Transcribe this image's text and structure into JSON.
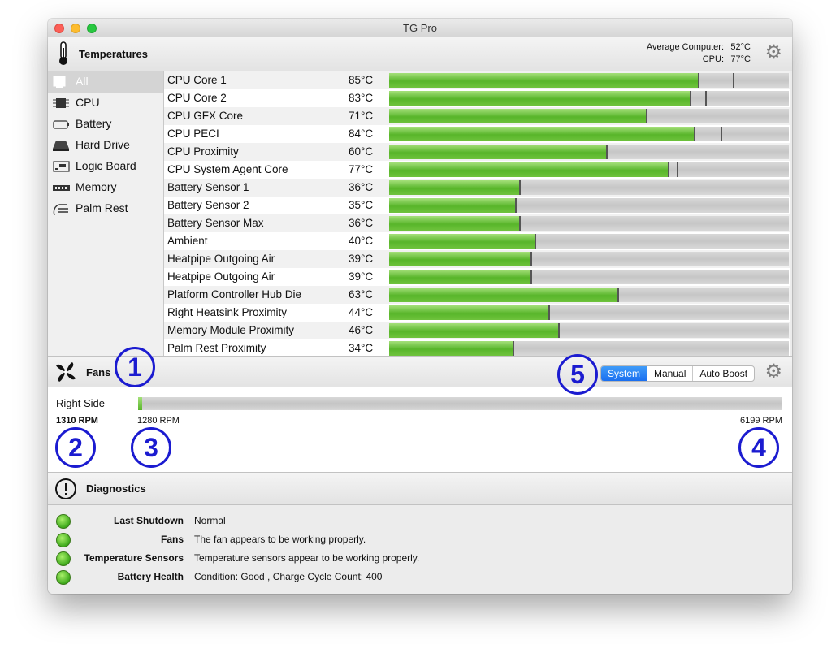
{
  "window": {
    "title": "TG Pro"
  },
  "temperatures": {
    "title": "Temperatures",
    "average_label": "Average Computer:",
    "average_value": "52°C",
    "cpu_label": "CPU:",
    "cpu_value": "77°C",
    "settings_icon": "gear-icon"
  },
  "sidebar": {
    "items": [
      {
        "label": "All",
        "icon": "all-icon",
        "selected": true
      },
      {
        "label": "CPU",
        "icon": "cpu-icon"
      },
      {
        "label": "Battery",
        "icon": "battery-icon"
      },
      {
        "label": "Hard Drive",
        "icon": "hard-drive-icon"
      },
      {
        "label": "Logic Board",
        "icon": "logic-board-icon"
      },
      {
        "label": "Memory",
        "icon": "memory-icon"
      },
      {
        "label": "Palm Rest",
        "icon": "palm-rest-icon"
      }
    ]
  },
  "sensors": [
    {
      "name": "CPU Core 1",
      "temp": "85°C",
      "level": 0.775,
      "max": 0.86
    },
    {
      "name": "CPU Core 2",
      "temp": "83°C",
      "level": 0.755,
      "max": 0.79
    },
    {
      "name": "CPU GFX Core",
      "temp": "71°C",
      "level": 0.645,
      "max": null
    },
    {
      "name": "CPU PECI",
      "temp": "84°C",
      "level": 0.765,
      "max": 0.83
    },
    {
      "name": "CPU Proximity",
      "temp": "60°C",
      "level": 0.545,
      "max": null
    },
    {
      "name": "CPU System Agent Core",
      "temp": "77°C",
      "level": 0.7,
      "max": 0.72
    },
    {
      "name": "Battery Sensor 1",
      "temp": "36°C",
      "level": 0.328,
      "max": null
    },
    {
      "name": "Battery Sensor 2",
      "temp": "35°C",
      "level": 0.318,
      "max": null
    },
    {
      "name": "Battery Sensor Max",
      "temp": "36°C",
      "level": 0.328,
      "max": null
    },
    {
      "name": "Ambient",
      "temp": "40°C",
      "level": 0.365,
      "max": null
    },
    {
      "name": "Heatpipe Outgoing Air",
      "temp": "39°C",
      "level": 0.355,
      "max": null
    },
    {
      "name": "Heatpipe Outgoing Air",
      "temp": "39°C",
      "level": 0.355,
      "max": null
    },
    {
      "name": "Platform Controller Hub Die",
      "temp": "63°C",
      "level": 0.573,
      "max": null
    },
    {
      "name": "Right Heatsink Proximity",
      "temp": "44°C",
      "level": 0.4,
      "max": null
    },
    {
      "name": "Memory Module Proximity",
      "temp": "46°C",
      "level": 0.425,
      "max": null
    },
    {
      "name": "Palm Rest Proximity",
      "temp": "34°C",
      "level": 0.31,
      "max": null
    }
  ],
  "fans": {
    "title": "Fans",
    "modes": [
      "System",
      "Manual",
      "Auto Boost"
    ],
    "active_mode": "System",
    "settings_icon": "gear-icon",
    "fan": {
      "name": "Right Side",
      "current_rpm": "1310 RPM",
      "min_rpm": "1280 RPM",
      "max_rpm": "6199 RPM",
      "level": 0.006
    }
  },
  "callouts": [
    "1",
    "2",
    "3",
    "4",
    "5"
  ],
  "diagnostics": {
    "title": "Diagnostics",
    "items": [
      {
        "label": "Last Shutdown",
        "value": "Normal",
        "status": "green"
      },
      {
        "label": "Fans",
        "value": "The fan appears to be working properly.",
        "status": "green"
      },
      {
        "label": "Temperature Sensors",
        "value": "Temperature sensors appear to be working properly.",
        "status": "green"
      },
      {
        "label": "Battery Health",
        "value": "Condition: Good , Charge Cycle Count: 400",
        "status": "green"
      }
    ]
  },
  "colors": {
    "bar_green": "#5cb82e",
    "selection_blue": "#1a6ff0",
    "callout_blue": "#1b1bd0"
  }
}
